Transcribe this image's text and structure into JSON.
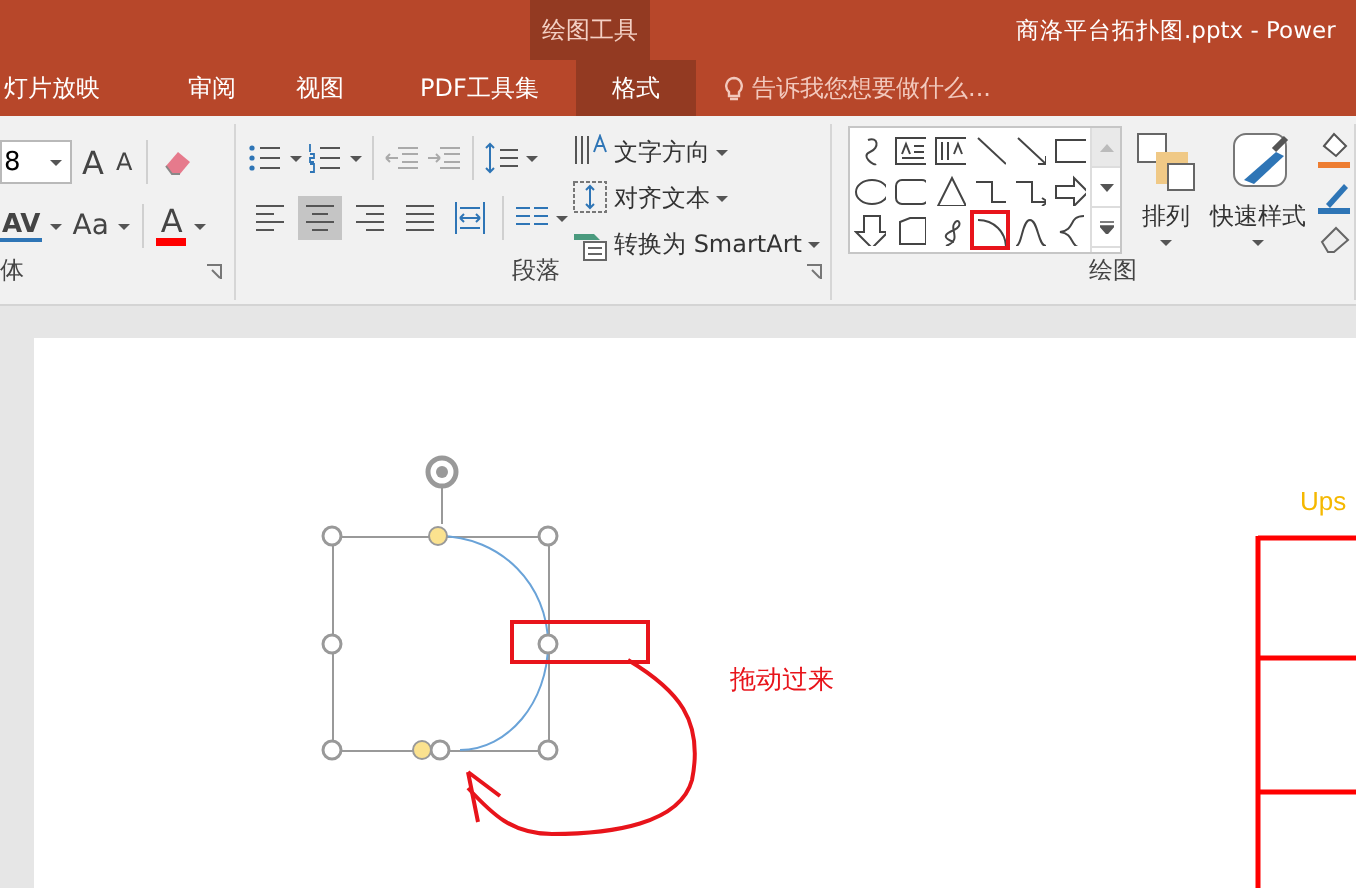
{
  "title_bar": {
    "context_label": "绘图工具",
    "document_title": "商洛平台拓扑图.pptx - Power"
  },
  "tabs": [
    {
      "label": "灯片放映",
      "selected": false
    },
    {
      "label": "审阅",
      "selected": false
    },
    {
      "label": "视图",
      "selected": false
    },
    {
      "label": "PDF工具集",
      "selected": false
    },
    {
      "label": "格式",
      "selected": true
    }
  ],
  "tell_me": {
    "placeholder": "告诉我您想要做什么..."
  },
  "font_group": {
    "font_size": "8",
    "grow_button": "A",
    "shrink_button": "A",
    "spacing_button": "AV",
    "case_button": "Aa",
    "color_button": "A",
    "label": "体"
  },
  "paragraph_group": {
    "alignments": [
      {
        "kind": "left",
        "selected": false
      },
      {
        "kind": "center",
        "selected": true
      },
      {
        "kind": "right",
        "selected": false
      },
      {
        "kind": "justify",
        "selected": false
      },
      {
        "kind": "distributed",
        "selected": false
      }
    ],
    "commands": [
      "文字方向",
      "对齐文本",
      "转换为 SmartArt"
    ],
    "label": "段落"
  },
  "drawing_group": {
    "shapes": [
      {
        "kind": "curve",
        "highlighted": false
      },
      {
        "kind": "textbox",
        "highlighted": false
      },
      {
        "kind": "vtextbox",
        "highlighted": false
      },
      {
        "kind": "line",
        "highlighted": false
      },
      {
        "kind": "arrowline",
        "highlighted": false
      },
      {
        "kind": "rect",
        "highlighted": false
      },
      {
        "kind": "oval",
        "highlighted": false
      },
      {
        "kind": "roundrect",
        "highlighted": false
      },
      {
        "kind": "triangle",
        "highlighted": false
      },
      {
        "kind": "elbow",
        "highlighted": false
      },
      {
        "kind": "elbowarrow",
        "highlighted": false
      },
      {
        "kind": "rightarrow",
        "highlighted": false
      },
      {
        "kind": "downarrow",
        "highlighted": false
      },
      {
        "kind": "flowshape",
        "highlighted": false
      },
      {
        "kind": "scribble",
        "highlighted": false
      },
      {
        "kind": "arc",
        "highlighted": true
      },
      {
        "kind": "wave",
        "highlighted": false
      },
      {
        "kind": "brace",
        "highlighted": false
      }
    ],
    "buttons": [
      "排列",
      "快速样式"
    ],
    "label": "绘图"
  },
  "slide": {
    "annotation": "拖动过来",
    "cut_label": "Ups"
  }
}
